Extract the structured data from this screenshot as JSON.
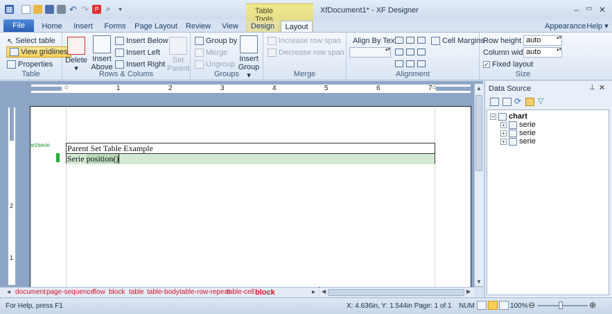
{
  "app": {
    "document_title": "XfDocument1* - XF Designer",
    "context_group": "Table Tools"
  },
  "tabs": {
    "file": "File",
    "home": "Home",
    "insert": "Insert",
    "forms": "Forms",
    "page_layout": "Page Layout",
    "review": "Review",
    "view": "View",
    "design": "Design",
    "layout": "Layout"
  },
  "menus": {
    "appearance": "Appearance ▾",
    "help": "Help ▾"
  },
  "ribbon": {
    "table": {
      "title": "Table",
      "select_table": "Select table",
      "view_gridlines": "View gridlines",
      "properties": "Properties"
    },
    "rows_cols": {
      "title": "Rows & Colums",
      "delete": "Delete",
      "insert_above": "Insert Above",
      "insert_below": "Insert Below",
      "insert_left": "Insert Left",
      "insert_right": "Insert Right",
      "set_parent": "Set Parent"
    },
    "groups": {
      "title": "Groups",
      "group_by": "Group by",
      "merge": "Merge",
      "ungroup": "Ungroup",
      "insert_group": "Insert Group ▾"
    },
    "merge": {
      "title": "Merge",
      "increase_row_span": "Increase row span",
      "decrease_row_span": "Decrease row span"
    },
    "alignment": {
      "title": "Alignment",
      "align_by_text": "Align By Text",
      "cell_margins": "Cell Margins"
    },
    "size": {
      "title": "Size",
      "row_height_label": "Row height",
      "row_height_value": "auto",
      "column_width_label": "Column width",
      "column_width_value": "auto",
      "fixed_layout": "Fixed layout"
    }
  },
  "ruler": {
    "h_numbers": [
      "1",
      "2",
      "3",
      "4",
      "5",
      "6",
      "7"
    ],
    "v_numbers": [
      "1",
      "2"
    ]
  },
  "document": {
    "binding_label": "art/serie",
    "row1": "Parent Set Table Example",
    "row2_prefix": "Serie ",
    "row2_field": "position()"
  },
  "breadcrumb": [
    "document",
    "page-sequence",
    "flow",
    "block",
    "table",
    "table-body",
    "table-row-repeat",
    "table-cell",
    "block"
  ],
  "data_source": {
    "title": "Data Source",
    "root": "chart",
    "children": [
      "serie",
      "serie",
      "serie"
    ]
  },
  "status": {
    "help": "For Help, press F1",
    "position": "X: 4.636in, Y: 1.544in Page: 1 of 1",
    "num": "NUM",
    "zoom": "100%"
  }
}
